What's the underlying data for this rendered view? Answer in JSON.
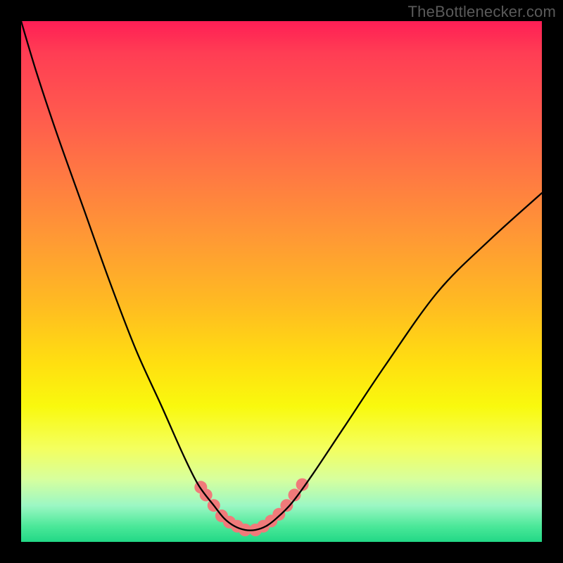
{
  "watermark": "TheBottleneсker.com",
  "chart_data": {
    "type": "line",
    "title": "",
    "xlabel": "",
    "ylabel": "",
    "xlim": [
      0,
      100
    ],
    "ylim": [
      0,
      100
    ],
    "series": [
      {
        "name": "bottleneck-curve",
        "x": [
          0,
          3,
          7,
          12,
          17,
          22,
          27,
          31,
          34,
          37,
          39,
          41,
          43,
          45,
          47,
          49,
          52,
          56,
          62,
          70,
          80,
          90,
          100
        ],
        "y": [
          100,
          90,
          78,
          64,
          50,
          37,
          26,
          17,
          11,
          7,
          4.5,
          3,
          2.3,
          2.3,
          3,
          4.5,
          7.5,
          13,
          22,
          34,
          48,
          58,
          67
        ]
      }
    ],
    "markers": {
      "name": "highlight-range",
      "color": "#f07a7a",
      "x": [
        34.5,
        35.5,
        37,
        38.5,
        40,
        41.5,
        43,
        45,
        46.5,
        48,
        49.5,
        51,
        52.5,
        54
      ],
      "y": [
        10.5,
        9,
        7,
        5,
        3.8,
        3,
        2.3,
        2.3,
        3,
        4,
        5.3,
        7,
        9,
        11
      ]
    },
    "gradient_stops": [
      {
        "pos": 0.0,
        "color": "#ff1e55"
      },
      {
        "pos": 0.3,
        "color": "#ff7a42"
      },
      {
        "pos": 0.66,
        "color": "#ffe010"
      },
      {
        "pos": 0.82,
        "color": "#f4ff5e"
      },
      {
        "pos": 1.0,
        "color": "#22d886"
      }
    ]
  }
}
